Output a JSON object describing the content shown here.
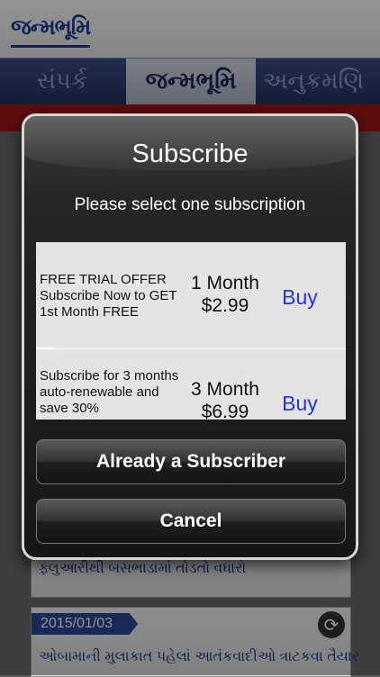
{
  "app": {
    "logo_text": "જન્મભૂમિ",
    "tabs": [
      {
        "label": "સંપર્ક"
      },
      {
        "label": "જન્મભૂમિ"
      },
      {
        "label": "અનુક્રમણિ"
      }
    ],
    "news": [
      {
        "headline": "ફ્લુઆરીથી બસભાડામાં તોડતો વધારો"
      },
      {
        "date": "2015/01/03",
        "headline": "ઓબામાની મુલાકાત પહેલાં આતંકવાદીઓ ત્રાટકવા તૈયાર"
      }
    ]
  },
  "dialog": {
    "title": "Subscribe",
    "subtitle": "Please select one subscription",
    "options": [
      {
        "description": "FREE TRIAL OFFER Subscribe Now to GET 1st Month FREE",
        "period": "1 Month",
        "price": "$2.99",
        "action": "Buy"
      },
      {
        "description": "Subscribe for 3 months auto-renewable and save 30%",
        "period": "3 Month",
        "price": "$6.99",
        "action": "Buy"
      }
    ],
    "already_label": "Already a Subscriber",
    "cancel_label": "Cancel"
  },
  "colors": {
    "brand_blue": "#1d3d8f",
    "buy_link": "#2435e6",
    "dialog_bg": "#161616"
  }
}
